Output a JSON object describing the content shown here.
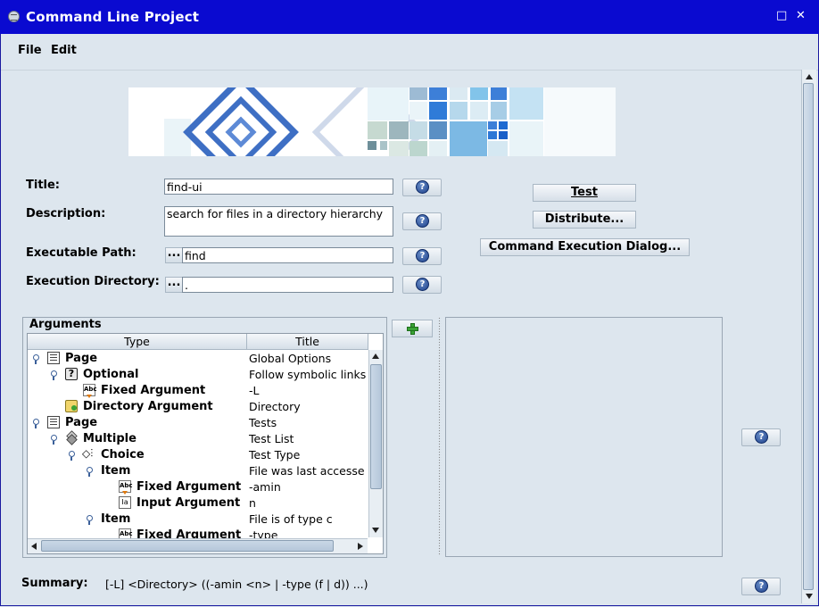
{
  "window": {
    "title": "Command Line Project",
    "maximize_glyph": "□",
    "close_glyph": "✕"
  },
  "menu": {
    "file": "File",
    "edit": "Edit"
  },
  "form": {
    "title_label": "Title:",
    "title_value": "find-ui",
    "description_label": "Description:",
    "description_value": "search for files in a directory hierarchy",
    "exec_path_label": "Executable Path:",
    "exec_path_value": "find",
    "exec_dir_label": "Execution Directory:",
    "exec_dir_value": ".",
    "browse_label": "..."
  },
  "actions": {
    "test": "Test",
    "distribute": "Distribute...",
    "command_dialog": "Command Execution Dialog..."
  },
  "arguments": {
    "legend": "Arguments",
    "columns": [
      "Type",
      "Title"
    ],
    "rows": [
      {
        "type": "Page",
        "title": "Global Options",
        "icon": "page-icon"
      },
      {
        "type": "Optional",
        "title": "Follow symbolic links",
        "icon": "optional-icon"
      },
      {
        "type": "Fixed Argument",
        "title": "-L",
        "icon": "fixed-argument-icon"
      },
      {
        "type": "Directory Argument",
        "title": "Directory",
        "icon": "directory-argument-icon"
      },
      {
        "type": "Page",
        "title": "Tests",
        "icon": "page-icon"
      },
      {
        "type": "Multiple",
        "title": "Test List",
        "icon": "multiple-icon"
      },
      {
        "type": "Choice",
        "title": "Test Type",
        "icon": "choice-icon"
      },
      {
        "type": "Item",
        "title": "File was last accesse",
        "icon": "none"
      },
      {
        "type": "Fixed Argument",
        "title": "-amin",
        "icon": "fixed-argument-icon"
      },
      {
        "type": "Input Argument",
        "title": "n",
        "icon": "input-argument-icon"
      },
      {
        "type": "Item",
        "title": "File is of type c",
        "icon": "none"
      },
      {
        "type": "Fixed Argument",
        "title": "-type",
        "icon": "fixed-argument-icon"
      }
    ]
  },
  "summary": {
    "label": "Summary:",
    "value": "[-L] <Directory> ((-amin <n> | -type (f | d)) ...)"
  },
  "colors": {
    "titlebar": "#0a0ad0",
    "background": "#dde6ee",
    "accent": "#3a5f99"
  }
}
